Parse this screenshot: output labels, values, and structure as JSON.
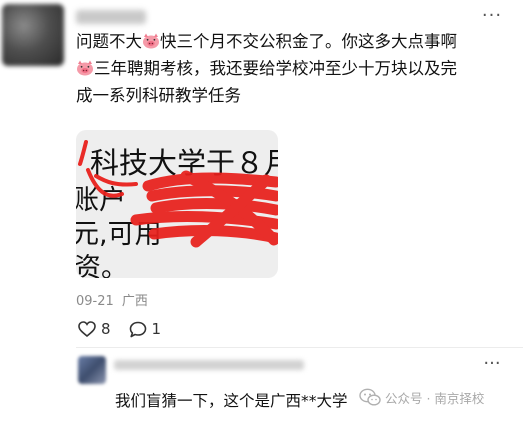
{
  "post": {
    "line1": "问题不大",
    "line1b": "快三个月不交公积金了。你这多大点事啊",
    "line2": "三年聘期考核，我还要给学校冲至少十万块以及完",
    "line3": "成一系列科研教学任务",
    "more_icon": "···",
    "emoji_icon": "pig-face-icon"
  },
  "photo": {
    "line1": "科技大学于８月",
    "line2": "账户",
    "line3": "元,可用",
    "line4": "资。",
    "scribble_color": "#e8201c"
  },
  "meta": {
    "date": "09-21",
    "location": "广西"
  },
  "actions": {
    "likes": "8",
    "comments": "1"
  },
  "comment": {
    "more_icon": "···",
    "text": "我们盲猜一下，这个是广西**大学"
  },
  "watermark": {
    "text": "公众号 · 南京择校"
  }
}
